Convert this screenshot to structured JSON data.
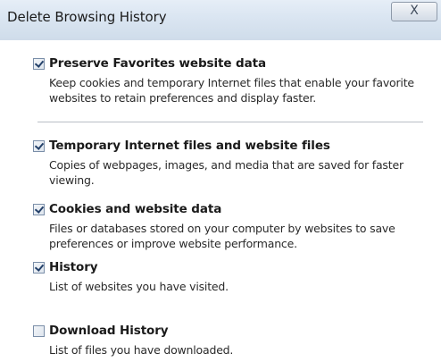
{
  "window": {
    "title": "Delete Browsing History",
    "close_label": "X"
  },
  "options": [
    {
      "title": "Preserve Favorites website data",
      "description": "Keep cookies and temporary Internet files that enable your favorite websites to retain preferences and display faster.",
      "checked": true
    },
    {
      "title": "Temporary Internet files and website files",
      "description": "Copies of webpages, images, and media that are saved for faster viewing.",
      "checked": true
    },
    {
      "title": "Cookies and website data",
      "description": "Files or databases stored on your computer by websites to save preferences or improve website performance.",
      "checked": true
    },
    {
      "title": "History",
      "description": "List of websites you have visited.",
      "checked": true
    },
    {
      "title": "Download History",
      "description": "List of files you have downloaded.",
      "checked": false
    }
  ],
  "colors": {
    "titlebar": "#dbe6f2",
    "checkmark": "#24416a",
    "divider": "#b9bec6"
  }
}
